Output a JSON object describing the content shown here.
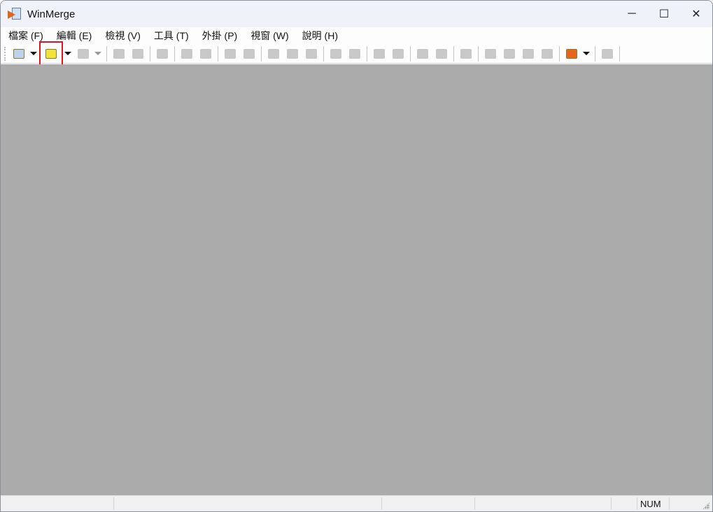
{
  "window": {
    "title": "WinMerge",
    "minimize": "─",
    "maximize": "☐",
    "close": "✕"
  },
  "menu": [
    "檔案 (F)",
    "編輯 (E)",
    "檢視 (V)",
    "工具 (T)",
    "外掛 (P)",
    "視窗 (W)",
    "說明 (H)"
  ],
  "toolbar": [
    {
      "name": "new-icon",
      "color": "#bcd3ee"
    },
    {
      "dd": true
    },
    {
      "name": "open-icon",
      "color": "#f2e33a",
      "active": true
    },
    {
      "dd": true
    },
    {
      "name": "save-icon",
      "disabled": true
    },
    {
      "dd": true,
      "disabled": true
    },
    {
      "sep": true
    },
    {
      "name": "undo-icon",
      "disabled": true
    },
    {
      "name": "redo-icon",
      "disabled": true
    },
    {
      "sep": true
    },
    {
      "name": "options-icon",
      "disabled": true
    },
    {
      "sep": true
    },
    {
      "name": "next-diff-icon",
      "disabled": true
    },
    {
      "name": "prev-diff-icon",
      "disabled": true
    },
    {
      "sep": true
    },
    {
      "name": "next-conflict-icon",
      "disabled": true
    },
    {
      "name": "prev-conflict-icon",
      "disabled": true
    },
    {
      "sep": true
    },
    {
      "name": "first-diff-icon",
      "disabled": true
    },
    {
      "name": "current-diff-icon",
      "disabled": true
    },
    {
      "name": "last-diff-icon",
      "disabled": true
    },
    {
      "sep": true
    },
    {
      "name": "copy-right-icon",
      "disabled": true
    },
    {
      "name": "copy-left-icon",
      "disabled": true
    },
    {
      "sep": true
    },
    {
      "name": "copy-right-advance-icon",
      "disabled": true
    },
    {
      "name": "copy-left-advance-icon",
      "disabled": true
    },
    {
      "sep": true
    },
    {
      "name": "all-right-icon",
      "disabled": true
    },
    {
      "name": "all-left-icon",
      "disabled": true
    },
    {
      "sep": true
    },
    {
      "name": "merge-icon",
      "disabled": true
    },
    {
      "sep": true
    },
    {
      "name": "first-file-icon",
      "disabled": true
    },
    {
      "name": "prev-file-icon",
      "disabled": true
    },
    {
      "name": "next-file-icon",
      "disabled": true
    },
    {
      "name": "last-file-icon",
      "disabled": true
    },
    {
      "sep": true
    },
    {
      "name": "plugin-wrench-icon",
      "color": "#e8641c"
    },
    {
      "dd": true
    },
    {
      "sep": true
    },
    {
      "name": "refresh-icon",
      "disabled": true
    },
    {
      "sep": true
    }
  ],
  "status": {
    "num": "NUM"
  }
}
